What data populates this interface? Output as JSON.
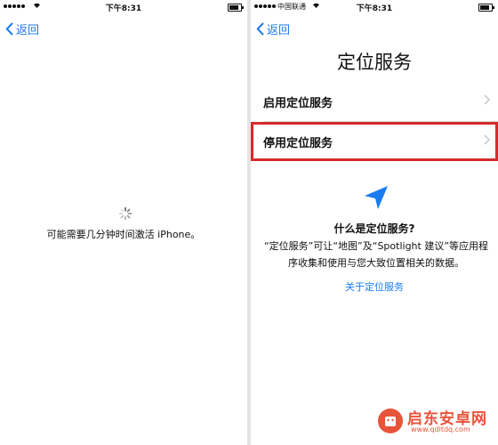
{
  "left_screen": {
    "status": {
      "time": "下午8:31"
    },
    "back_label": "返回",
    "wait_message": "可能需要几分钟时间激活 iPhone。"
  },
  "right_screen": {
    "status": {
      "carrier": "中国联通",
      "time": "下午8:31"
    },
    "back_label": "返回",
    "title": "定位服务",
    "options": [
      {
        "label": "启用定位服务"
      },
      {
        "label": "停用定位服务",
        "highlighted": true
      }
    ],
    "about_title": "什么是定位服务?",
    "about_description": "“定位服务”可让“地图”及“Spotlight 建议”等应用程序收集和使用与您大致位置相关的数据。",
    "about_link": "关于定位服务"
  },
  "watermark": {
    "name": "启东安卓网",
    "url": "www.qdltdq.com"
  },
  "colors": {
    "accent": "#1a7cf0",
    "highlight_border": "#d62b2b",
    "watermark": "#e8543a"
  },
  "icons": [
    "signal-dots-icon",
    "wifi-icon",
    "battery-icon",
    "back-chevron-icon",
    "spinner-icon",
    "chevron-right-icon",
    "location-arrow-icon"
  ]
}
